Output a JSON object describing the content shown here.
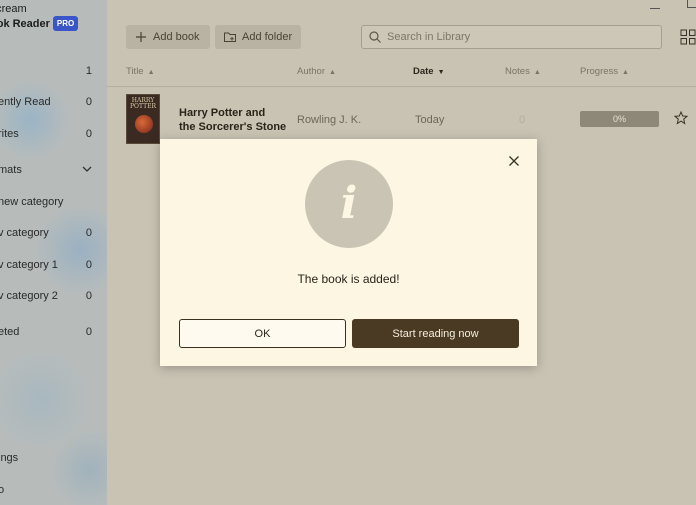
{
  "app": {
    "brand_line1": "ecream",
    "brand_line2": "ook Reader",
    "badge": "PRO"
  },
  "sidebar": {
    "items": [
      {
        "label": "",
        "count": "1"
      },
      {
        "label": "ently Read",
        "count": "0"
      },
      {
        "label": "rites",
        "count": "0"
      },
      {
        "label": "mats",
        "count": ""
      },
      {
        "label": "new category",
        "count": ""
      },
      {
        "label": "v category",
        "count": "0"
      },
      {
        "label": "v category 1",
        "count": "0"
      },
      {
        "label": "v category 2",
        "count": "0"
      },
      {
        "label": "eted",
        "count": "0"
      },
      {
        "label": "ings",
        "count": ""
      },
      {
        "label": "o",
        "count": ""
      }
    ]
  },
  "toolbar": {
    "add_book": "Add book",
    "add_folder": "Add folder",
    "search_placeholder": "Search in Library"
  },
  "columns": {
    "title": "Title",
    "author": "Author",
    "date": "Date",
    "notes": "Notes",
    "progress": "Progress"
  },
  "book": {
    "cover_text": "HARRY POTTER",
    "title_line1": "Harry Potter and",
    "title_line2": "the Sorcerer's Stone",
    "author": "Rowling J. K.",
    "date": "Today",
    "notes": "0",
    "progress": 0,
    "progress_text": "0%"
  },
  "dialog": {
    "icon": "info-icon",
    "message": "The book is added!",
    "ok_label": "OK",
    "start_label": "Start reading now"
  },
  "colors": {
    "modal_bg": "#fcf6e3",
    "primary_button": "#4a3a24",
    "pro_badge": "#3a55c8"
  }
}
